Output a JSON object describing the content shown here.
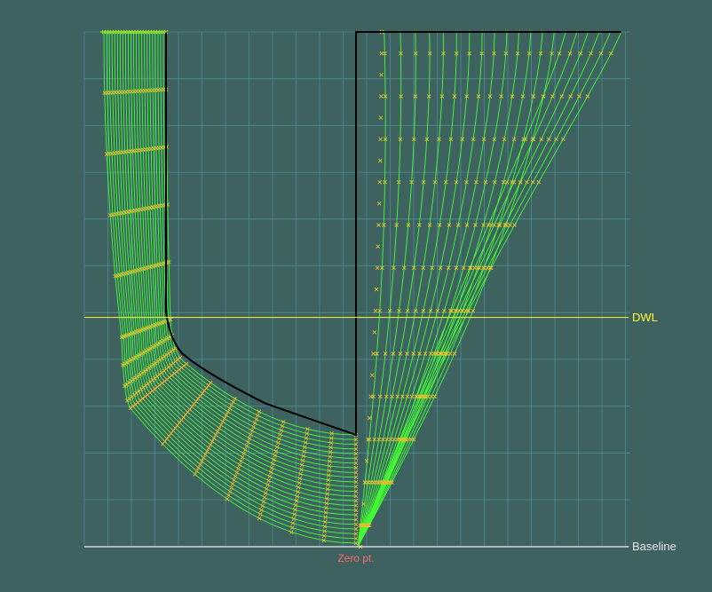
{
  "view": {
    "title": "",
    "colors": {
      "background": "#3d6260",
      "grid": "#4f8c93",
      "station": "#44ff33",
      "points": "#e0c030",
      "outline": "#000000",
      "dwl": "#ffff33",
      "baseline": "#e8e8e8",
      "zero": "#ff6a6a"
    }
  },
  "labels": {
    "dwl": "DWL",
    "baseline": "Baseline",
    "zero": "Zero pt."
  },
  "chart_data": {
    "type": "line",
    "view": "body plan",
    "left_half": "aft stations (mirrored)",
    "right_half": "forward stations",
    "station_count_aft": 24,
    "station_count_fwd": 20,
    "xlim": [
      -1,
      1
    ],
    "ylim": [
      0,
      1.1
    ],
    "dwl": 0.49,
    "grid": true,
    "legend": "none"
  }
}
